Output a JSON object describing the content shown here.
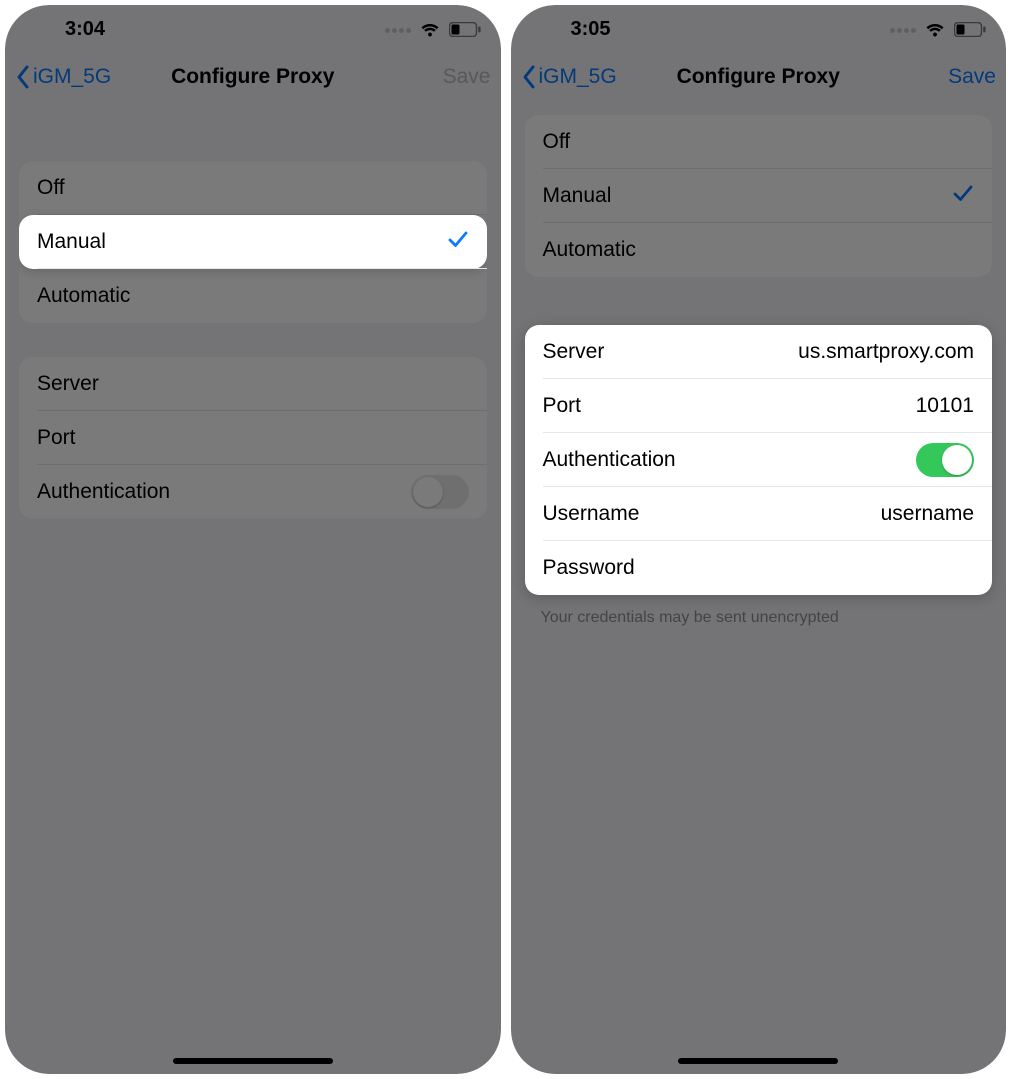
{
  "left": {
    "status": {
      "time": "3:04"
    },
    "nav": {
      "back_label": "iGM_5G",
      "title": "Configure Proxy",
      "save_label": "Save",
      "save_enabled": false
    },
    "modes": {
      "off": {
        "label": "Off",
        "selected": false
      },
      "manual": {
        "label": "Manual",
        "selected": true
      },
      "auto": {
        "label": "Automatic",
        "selected": false
      }
    },
    "fields": {
      "server": {
        "label": "Server",
        "value": ""
      },
      "port": {
        "label": "Port",
        "value": ""
      },
      "auth": {
        "label": "Authentication",
        "on": false
      }
    }
  },
  "right": {
    "status": {
      "time": "3:05"
    },
    "nav": {
      "back_label": "iGM_5G",
      "title": "Configure Proxy",
      "save_label": "Save",
      "save_enabled": true
    },
    "modes": {
      "off": {
        "label": "Off",
        "selected": false
      },
      "manual": {
        "label": "Manual",
        "selected": true
      },
      "auto": {
        "label": "Automatic",
        "selected": false
      }
    },
    "fields": {
      "server": {
        "label": "Server",
        "value": "us.smartproxy.com"
      },
      "port": {
        "label": "Port",
        "value": "10101"
      },
      "auth": {
        "label": "Authentication",
        "on": true
      },
      "user": {
        "label": "Username",
        "value": "username"
      },
      "pass": {
        "label": "Password",
        "value": ""
      }
    },
    "footer": "Your credentials may be sent unencrypted"
  }
}
